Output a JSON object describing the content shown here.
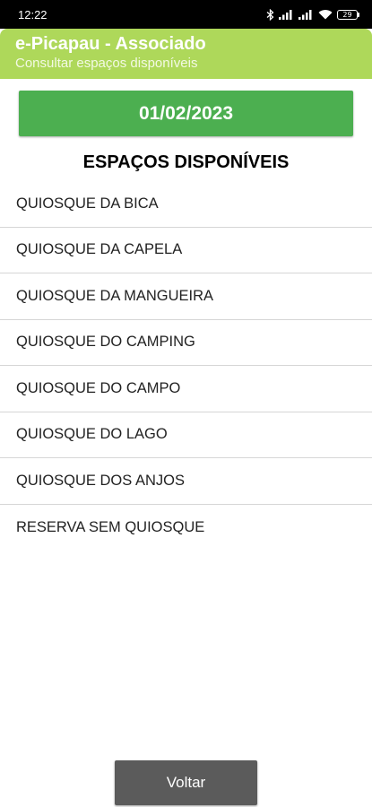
{
  "status_bar": {
    "time": "12:22",
    "battery": "29",
    "icons": [
      "bluetooth-icon",
      "signal-icon",
      "signal-icon",
      "wifi-icon",
      "battery-icon"
    ]
  },
  "app_bar": {
    "title": "e-Picapau - Associado",
    "subtitle": "Consultar espaços disponíveis",
    "color": "#aed85a"
  },
  "date_button": {
    "label": "01/02/2023",
    "color": "#4caf50"
  },
  "section_title": "ESPAÇOS DISPONÍVEIS",
  "spaces": [
    {
      "label": "QUIOSQUE DA BICA"
    },
    {
      "label": "QUIOSQUE DA CAPELA"
    },
    {
      "label": "QUIOSQUE DA MANGUEIRA"
    },
    {
      "label": "QUIOSQUE DO CAMPING"
    },
    {
      "label": "QUIOSQUE DO CAMPO"
    },
    {
      "label": "QUIOSQUE DO LAGO"
    },
    {
      "label": "QUIOSQUE DOS ANJOS"
    },
    {
      "label": "RESERVA SEM QUIOSQUE"
    }
  ],
  "back_button": {
    "label": "Voltar",
    "color": "#5b5b5b"
  }
}
